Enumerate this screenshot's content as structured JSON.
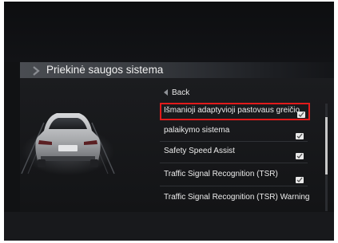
{
  "header": {
    "title": "Priekinė saugos sistema"
  },
  "menu": {
    "back_label": "Back",
    "items": [
      {
        "label": "Išmanioji adaptyvioji pastovaus greičio",
        "checked": true,
        "selected": true
      },
      {
        "label": "palaikymo sistema",
        "checked": true,
        "selected": false
      },
      {
        "label": "Safety Speed Assist",
        "checked": true,
        "selected": false
      },
      {
        "label": "Traffic Signal Recognition (TSR)",
        "checked": true,
        "selected": false
      },
      {
        "label": "Traffic Signal Recognition (TSR) Warning",
        "checked": false,
        "selected": false
      }
    ]
  },
  "icons": {
    "title": "chevron-right-icon",
    "back": "back-arrow-icon",
    "checkbox": "checkmark-icon",
    "illustration": "car-rear-illustration"
  },
  "colors": {
    "selection_border": "#e21b1b",
    "background": "#111214",
    "text": "#ececec"
  }
}
